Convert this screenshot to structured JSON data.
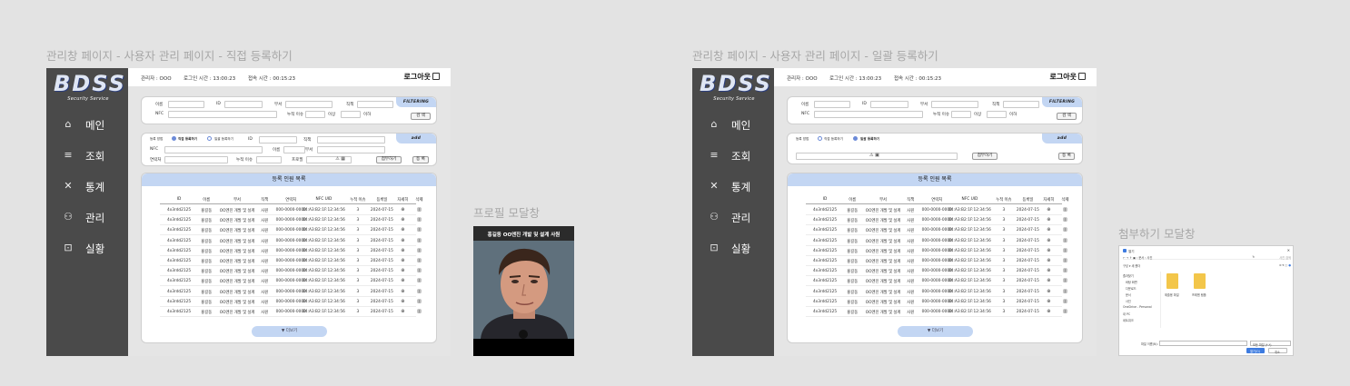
{
  "left_title": "관리창 페이지 - 사용자 관리 페이지 - 직접 등록하기",
  "right_title": "관리창 페이지 - 사용자 관리 페이지 - 일괄 등록하기",
  "profile_modal_title": "프로필 모달창",
  "attach_modal_title": "첨부하기 모달창",
  "logo": {
    "main": "BDSS",
    "sub": "Security Service"
  },
  "nav": [
    {
      "label": "메인",
      "icon": "home-icon",
      "glyph": "⌂"
    },
    {
      "label": "조회",
      "icon": "list-icon",
      "glyph": "≡"
    },
    {
      "label": "통계",
      "icon": "chart-icon",
      "glyph": "✕"
    },
    {
      "label": "관리",
      "icon": "users-icon",
      "glyph": "⚇"
    },
    {
      "label": "실황",
      "icon": "monitor-icon",
      "glyph": "⊡"
    }
  ],
  "topbar": {
    "admin": "관리자 : OOO",
    "login_time": "로그인 시간 : 13:00:23",
    "session_time": "접속 시간 : 00:15:23",
    "logout": "로그아웃"
  },
  "filter": {
    "tag": "FILTERING",
    "name": "이름",
    "id": "ID",
    "dept": "부서",
    "rank": "직책",
    "nfc": "NFC",
    "violations": "누적 이슈",
    "above": "이상",
    "below": "이하",
    "search": "검 색"
  },
  "register": {
    "tag": "add",
    "method": "등록 방법",
    "direct": "직접 등록하기",
    "bulk": "일괄 등록하기",
    "id": "ID",
    "rank": "직책",
    "nfc": "NFC",
    "name": "이름",
    "dept": "부서",
    "contact": "연락처",
    "violations": "누적 이슈",
    "profile": "프로필",
    "attach": "첨부하기",
    "submit": "등 록"
  },
  "list": {
    "title": "등록 인원 목록",
    "headers": [
      "ID",
      "이름",
      "부서",
      "직책",
      "연락처",
      "NFC UID",
      "누적 이슈",
      "등록일",
      "자세히",
      "삭제"
    ],
    "rows": [
      [
        "4x3rdd2125",
        "홍길동",
        "OO엔진 개발 및 설계",
        "사원",
        "000-0000-0000",
        "04:A3:B2:1F:12:34:56",
        "3",
        "2024-07-15"
      ],
      [
        "4x3rdd2125",
        "홍길동",
        "OO엔진 개발 및 설계",
        "사원",
        "000-0000-0000",
        "04:A3:B2:1F:12:34:56",
        "3",
        "2024-07-15"
      ],
      [
        "4x3rdd2125",
        "홍길동",
        "OO엔진 개발 및 설계",
        "사원",
        "000-0000-0000",
        "04:A3:B2:1F:12:34:56",
        "3",
        "2024-07-15"
      ],
      [
        "4x3rdd2125",
        "홍길동",
        "OO엔진 개발 및 설계",
        "사원",
        "000-0000-0000",
        "04:A3:B2:1F:12:34:56",
        "3",
        "2024-07-15"
      ],
      [
        "4x3rdd2125",
        "홍길동",
        "OO엔진 개발 및 설계",
        "사원",
        "000-0000-0000",
        "04:A3:B2:1F:12:34:56",
        "3",
        "2024-07-15"
      ],
      [
        "4x3rdd2125",
        "홍길동",
        "OO엔진 개발 및 설계",
        "사원",
        "000-0000-0000",
        "04:A3:B2:1F:12:34:56",
        "3",
        "2024-07-15"
      ],
      [
        "4x3rdd2125",
        "홍길동",
        "OO엔진 개발 및 설계",
        "사원",
        "000-0000-0000",
        "04:A3:B2:1F:12:34:56",
        "3",
        "2024-07-15"
      ],
      [
        "4x3rdd2125",
        "홍길동",
        "OO엔진 개발 및 설계",
        "사원",
        "000-0000-0000",
        "04:A3:B2:1F:12:34:56",
        "3",
        "2024-07-15"
      ],
      [
        "4x3rdd2125",
        "홍길동",
        "OO엔진 개발 및 설계",
        "사원",
        "000-0000-0000",
        "04:A3:B2:1F:12:34:56",
        "3",
        "2024-07-15"
      ],
      [
        "4x3rdd2125",
        "홍길동",
        "OO엔진 개발 및 설계",
        "사원",
        "000-0000-0000",
        "04:A3:B2:1F:12:34:56",
        "3",
        "2024-07-15"
      ],
      [
        "4x3rdd2125",
        "홍길동",
        "OO엔진 개발 및 설계",
        "사원",
        "000-0000-0000",
        "04:A3:B2:1F:12:34:56",
        "3",
        "2024-07-15"
      ]
    ],
    "more": "▼ 더보기"
  },
  "profile_modal": {
    "caption": "홍길동 OO엔진 개발 및 설계 사원"
  },
  "attach_modal": {
    "title": "열기",
    "tree": [
      "즐겨찾기",
      "바탕 화면",
      "다운로드",
      "문서",
      "사진",
      "OneDrive - Personal",
      "내 PC",
      "네트워크"
    ],
    "folders": [
      "제출용 파일",
      "프레젠 템플"
    ],
    "filename_label": "파일 이름(N):",
    "filetype": "모든 파일 (*.*)",
    "open": "열기(O)",
    "cancel": "취소"
  },
  "colors": {
    "sidebar": "#4a4a4a",
    "accent": "#c3d6f3",
    "radio": "#6c8bd8"
  }
}
